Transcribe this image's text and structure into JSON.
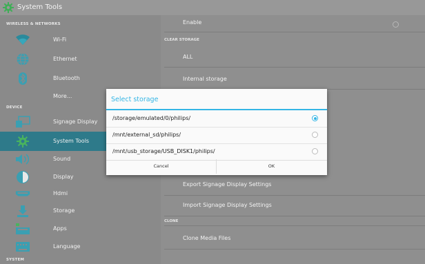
{
  "app": {
    "title": "System Tools"
  },
  "sidebar": {
    "sections": [
      {
        "label": "WIRELESS & NETWORKS"
      },
      {
        "label": "DEVICE"
      },
      {
        "label": "SYSTEM"
      }
    ],
    "items": [
      {
        "label": "Wi-Fi",
        "icon": "wifi-icon"
      },
      {
        "label": "Ethernet",
        "icon": "globe-icon"
      },
      {
        "label": "Bluetooth",
        "icon": "bluetooth-icon"
      },
      {
        "label": "More...",
        "icon": ""
      },
      {
        "label": "Signage Display",
        "icon": "display-icon"
      },
      {
        "label": "System Tools",
        "icon": "gear-icon",
        "active": true
      },
      {
        "label": "Sound",
        "icon": "speaker-icon"
      },
      {
        "label": "Display",
        "icon": "brightness-icon"
      },
      {
        "label": "Hdmi",
        "icon": "hdmi-icon"
      },
      {
        "label": "Storage",
        "icon": "storage-icon"
      },
      {
        "label": "Apps",
        "icon": "apps-icon"
      },
      {
        "label": "Language",
        "icon": "keyboard-icon"
      }
    ]
  },
  "content": {
    "enable_label": "Enable",
    "clear_storage_section": "CLEAR STORAGE",
    "all_label": "ALL",
    "internal_storage_label": "Internal storage",
    "export_label": "Export Signage Display Settings",
    "import_label": "Import Signage Display Settings",
    "clone_section": "CLONE",
    "clone_media_label": "Clone Media Files"
  },
  "dialog": {
    "title": "Select storage",
    "options": [
      {
        "label": "/storage/emulated/0/philips/",
        "selected": true
      },
      {
        "label": "/mnt/external_sd/philips/",
        "selected": false
      },
      {
        "label": "/mnt/usb_storage/USB_DISK1/philips/",
        "selected": false
      }
    ],
    "cancel_label": "Cancel",
    "ok_label": "OK"
  },
  "colors": {
    "accent": "#33b5e5",
    "active_item": "#2e7a8a"
  }
}
